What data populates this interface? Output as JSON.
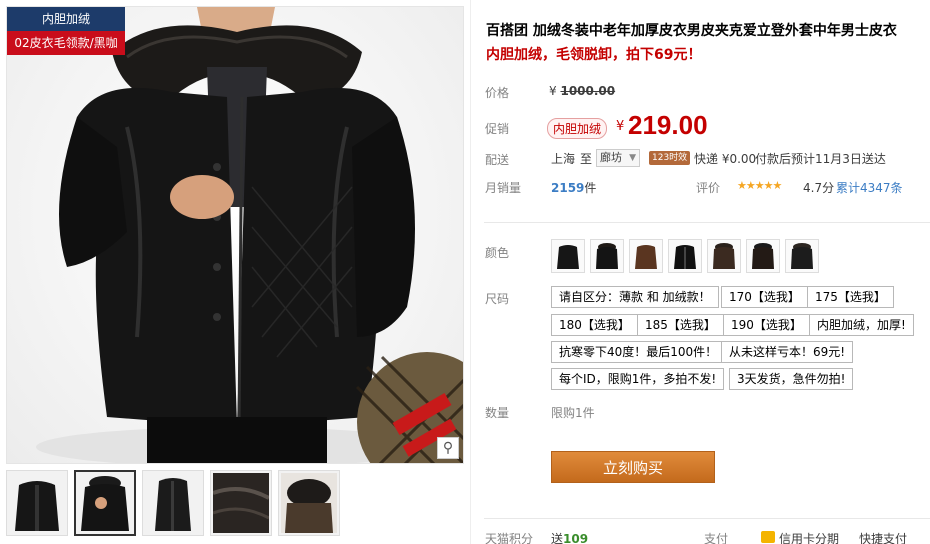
{
  "gallery": {
    "badge_primary": "内胆加绒",
    "badge_secondary": "02皮衣毛领款/黑咖",
    "zoom_icon": "magnifier-icon",
    "thumbnails": 5
  },
  "product": {
    "title": "百搭团 加绒冬装中老年加厚皮衣男皮夹克爱立登外套中年男士皮衣",
    "subtitle": "内胆加绒，毛领脱卸，拍下69元！"
  },
  "price": {
    "label": "价格",
    "currency": "¥",
    "original": "1000.00"
  },
  "promo": {
    "label": "促销",
    "tag": "内胆加绒",
    "currency": "¥",
    "price": "219.00"
  },
  "shipping": {
    "label": "配送",
    "origin": "上海",
    "to": "至",
    "destination": "廊坊",
    "badge": "123时效",
    "carrier": "快递 ¥0.00",
    "eta": "付款后预计11月3日送达"
  },
  "sales": {
    "label": "月销量",
    "count": "2159",
    "unit": "件",
    "rating_label": "评价",
    "stars": "★★★★★",
    "score": "4.7分",
    "reviews": "累计4347条"
  },
  "color": {
    "label": "颜色",
    "swatch_count": 7
  },
  "size": {
    "label": "尺码",
    "options": [
      "请自区分：薄款 和 加绒款！",
      "170【选我】",
      "175【选我】",
      "180【选我】",
      "185【选我】",
      "190【选我】",
      "内胆加绒，加厚!",
      "抗寒零下40度！最后100件！",
      "从未这样亏本！69元!",
      "每个ID，限购1件，多拍不发!",
      "3天发货，急件勿拍!"
    ]
  },
  "quantity": {
    "label": "数量",
    "limit": "限购1件"
  },
  "buy_button": "立刻购买",
  "bottom": {
    "points_label": "天猫积分",
    "points_prefix": "送",
    "points_value": "109",
    "pay_label": "支付",
    "pay_option_1": "信用卡分期",
    "pay_option_2": "快捷支付"
  }
}
